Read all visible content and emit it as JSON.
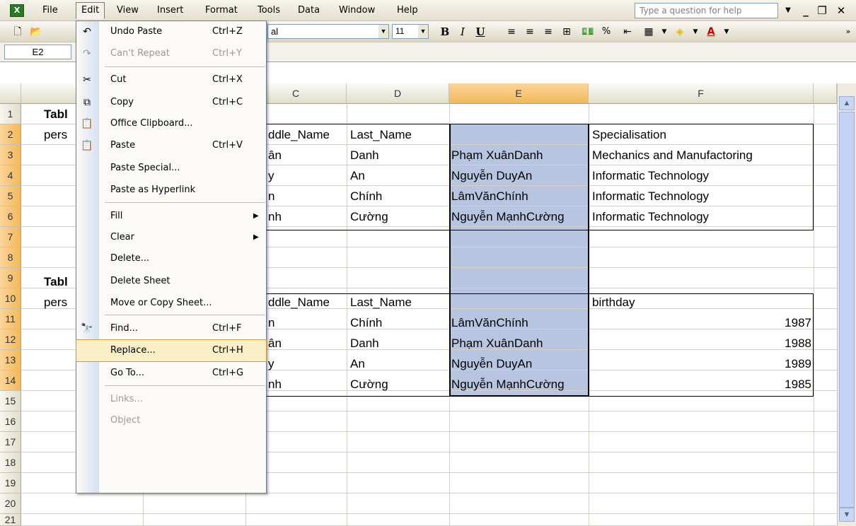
{
  "app": {
    "accent": "#b7c5e1",
    "highlight": "#fbefc8"
  },
  "menubar": {
    "items": [
      "File",
      "Edit",
      "View",
      "Insert",
      "Format",
      "Tools",
      "Data",
      "Window",
      "Help"
    ],
    "help_placeholder": "Type a question for help"
  },
  "toolbar": {
    "font": "al",
    "size": "11",
    "bold": "B",
    "italic": "I",
    "underline": "U",
    "percent": "%"
  },
  "namebox": "E2",
  "columns": [
    "C",
    "D",
    "E",
    "F"
  ],
  "rows": [
    "1",
    "2",
    "3",
    "4",
    "5",
    "6",
    "7",
    "8",
    "9",
    "10",
    "11",
    "12",
    "13",
    "14",
    "15",
    "16",
    "17",
    "18",
    "19",
    "20",
    "21"
  ],
  "cells": {
    "a1": "Tabl",
    "a2": "pers",
    "a9": "Tabl",
    "a10": "pers",
    "c2": "ddle_Name",
    "d2": "Last_Name",
    "f2": "Specialisation",
    "c3": "ân",
    "d3": "Danh",
    "e3": "Phạm XuânDanh",
    "f3": "Mechanics and Manufactoring",
    "c4": "y",
    "d4": "An",
    "e4": "Nguyễn DuyAn",
    "f4": "Informatic Technology",
    "c5": "n",
    "d5": "Chính",
    "e5": "LâmVănChính",
    "f5": "Informatic Technology",
    "c6": "nh",
    "d6": "Cường",
    "e6": "Nguyễn MạnhCường",
    "f6": "Informatic Technology",
    "c10": "ddle_Name",
    "d10": "Last_Name",
    "f10": "birthday",
    "c11": "n",
    "d11": "Chính",
    "e11": "LâmVănChính",
    "f11": "1987",
    "c12": "ân",
    "d12": "Danh",
    "e12": "Phạm XuânDanh",
    "f12": "1988",
    "c13": "y",
    "d13": "An",
    "e13": "Nguyễn DuyAn",
    "f13": "1989",
    "c14": "nh",
    "d14": "Cường",
    "e14": "Nguyễn MạnhCường",
    "f14": "1985"
  },
  "edit_menu": {
    "items": [
      {
        "label": "Undo Paste",
        "shortcut": "Ctrl+Z",
        "icon": "undo-icon"
      },
      {
        "label": "Can't Repeat",
        "shortcut": "Ctrl+Y",
        "icon": "redo-icon"
      },
      {
        "label": "Cut",
        "shortcut": "Ctrl+X",
        "icon": "scissors-icon"
      },
      {
        "label": "Copy",
        "shortcut": "Ctrl+C",
        "icon": "copy-icon"
      },
      {
        "label": "Office Clipboard...",
        "shortcut": "",
        "icon": "clipboard-icon"
      },
      {
        "label": "Paste",
        "shortcut": "Ctrl+V",
        "icon": "paste-icon"
      },
      {
        "label": "Paste Special...",
        "shortcut": "",
        "icon": ""
      },
      {
        "label": "Paste as Hyperlink",
        "shortcut": "",
        "icon": ""
      },
      {
        "label": "Fill",
        "shortcut": "",
        "icon": ""
      },
      {
        "label": "Clear",
        "shortcut": "",
        "icon": ""
      },
      {
        "label": "Delete...",
        "shortcut": "",
        "icon": ""
      },
      {
        "label": "Delete Sheet",
        "shortcut": "",
        "icon": ""
      },
      {
        "label": "Move or Copy Sheet...",
        "shortcut": "",
        "icon": ""
      },
      {
        "label": "Find...",
        "shortcut": "Ctrl+F",
        "icon": "binoculars-icon"
      },
      {
        "label": "Replace...",
        "shortcut": "Ctrl+H",
        "icon": ""
      },
      {
        "label": "Go To...",
        "shortcut": "Ctrl+G",
        "icon": ""
      },
      {
        "label": "Links...",
        "shortcut": "",
        "icon": ""
      },
      {
        "label": "Object",
        "shortcut": "",
        "icon": ""
      }
    ]
  }
}
